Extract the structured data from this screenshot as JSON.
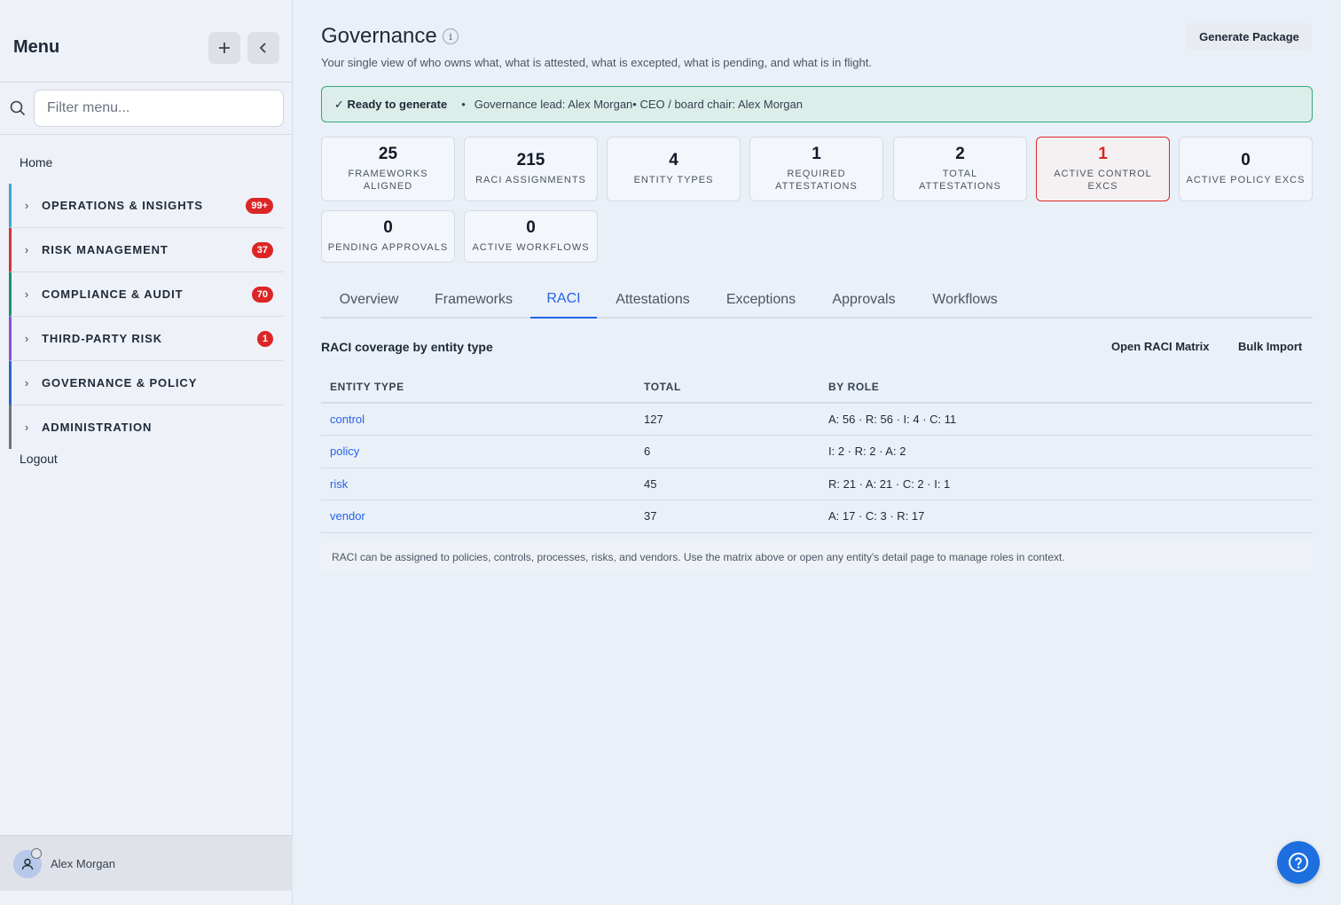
{
  "sidebar": {
    "title": "Menu",
    "add_icon": "plus-icon",
    "collapse_icon": "chevron-left-icon",
    "filter_placeholder": "Filter menu...",
    "home": "Home",
    "groups": [
      {
        "label": "OPERATIONS & INSIGHTS",
        "badge": "99+",
        "color": "#3aa7d6"
      },
      {
        "label": "RISK MANAGEMENT",
        "badge": "37",
        "color": "#d3343a"
      },
      {
        "label": "COMPLIANCE & AUDIT",
        "badge": "70",
        "color": "#1f8f6a"
      },
      {
        "label": "THIRD-PARTY RISK",
        "badge": "1",
        "color": "#8b4fd8"
      },
      {
        "label": "GOVERNANCE & POLICY",
        "badge": "",
        "color": "#2f62c9"
      },
      {
        "label": "ADMINISTRATION",
        "badge": "",
        "color": "#6b7280"
      }
    ],
    "logout": "Logout",
    "user_name": "Alex Morgan"
  },
  "header": {
    "title": "Governance",
    "info_label": "i",
    "subtitle": "Your single view of who owns what, what is attested, what is excepted, what is pending, and what is in flight.",
    "generate_button": "Generate Package"
  },
  "banner": {
    "ready": "✓ Ready to generate",
    "bullet": "•",
    "lead": "Governance lead: Alex Morgan",
    "ceo": "• CEO / board chair: Alex Morgan"
  },
  "stats": [
    {
      "value": "25",
      "label": "FRAMEWORKS ALIGNED"
    },
    {
      "value": "215",
      "label": "RACI ASSIGNMENTS"
    },
    {
      "value": "4",
      "label": "ENTITY TYPES"
    },
    {
      "value": "1",
      "label": "REQUIRED ATTESTATIONS"
    },
    {
      "value": "2",
      "label": "TOTAL ATTESTATIONS"
    },
    {
      "value": "1",
      "label": "ACTIVE CONTROL EXCS"
    },
    {
      "value": "0",
      "label": "ACTIVE POLICY EXCS"
    },
    {
      "value": "0",
      "label": "PENDING APPROVALS"
    },
    {
      "value": "0",
      "label": "ACTIVE WORKFLOWS"
    }
  ],
  "tabs": [
    "Overview",
    "Frameworks",
    "RACI",
    "Attestations",
    "Exceptions",
    "Approvals",
    "Workflows"
  ],
  "active_tab": "RACI",
  "section": {
    "title": "RACI coverage by entity type",
    "open_matrix": "Open RACI Matrix",
    "bulk_import": "Bulk Import"
  },
  "table": {
    "headers": [
      "ENTITY TYPE",
      "TOTAL",
      "BY ROLE"
    ],
    "rows": [
      {
        "entity": "control",
        "total": "127",
        "by_role": "A: 56 · R: 56 · I: 4 · C: 11"
      },
      {
        "entity": "policy",
        "total": "6",
        "by_role": "I: 2 · R: 2 · A: 2"
      },
      {
        "entity": "risk",
        "total": "45",
        "by_role": "R: 21 · A: 21 · C: 2 · I: 1"
      },
      {
        "entity": "vendor",
        "total": "37",
        "by_role": "A: 17 · C: 3 · R: 17"
      }
    ],
    "note": "RACI can be assigned to policies, controls, processes, risks, and vendors. Use the matrix above or open any entity's detail page to manage roles in context."
  },
  "help_icon": "question-circle-icon",
  "colors": {
    "accent": "#2563eb",
    "alert": "#dc2626",
    "success_border": "#34a877"
  }
}
